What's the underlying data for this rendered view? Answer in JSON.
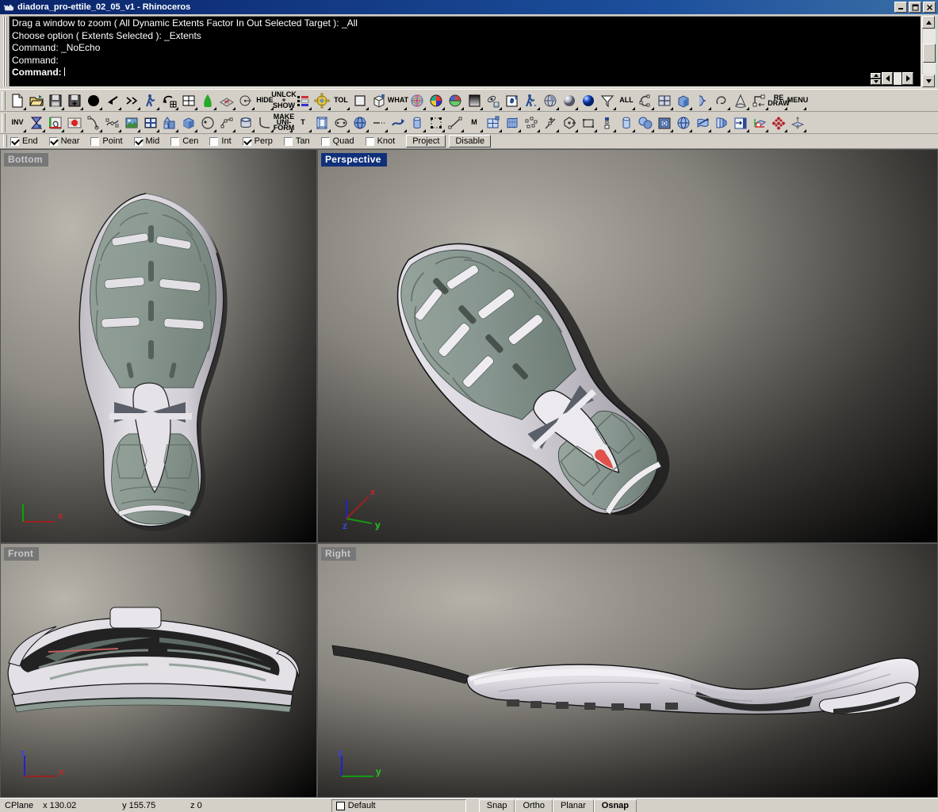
{
  "window": {
    "title": "diadora_pro-ettile_02_05_v1 - Rhinoceros",
    "app_icon": "rhino-icon",
    "minimize": "_",
    "maximize": "□",
    "close": "×"
  },
  "command_area": {
    "history": [
      "Drag a window to zoom ( All  Dynamic  Extents  Factor  In  Out  Selected  Target ): _All",
      "Choose option ( Extents  Selected ): _Extents",
      "Command: _NoEcho",
      "Command:"
    ],
    "prompt": "Command:",
    "input_value": ""
  },
  "toolbar_row1": [
    {
      "name": "new-file-button",
      "label": "",
      "icon": "new-page-icon"
    },
    {
      "name": "open-file-button",
      "label": "",
      "icon": "open-folder-icon"
    },
    {
      "name": "save-file-button",
      "label": "",
      "icon": "floppy-save-icon"
    },
    {
      "name": "save-as-button",
      "label": "",
      "icon": "floppy-save-as-icon"
    },
    {
      "name": "select-all-solid-button",
      "label": "",
      "icon": "filled-circle-icon"
    },
    {
      "name": "undo-button",
      "label": "",
      "icon": "undo-arrow-icon"
    },
    {
      "name": "redo-button",
      "label": "",
      "icon": "redo-arrow-icon"
    },
    {
      "name": "walk-person-button",
      "label": "",
      "icon": "walking-person-icon"
    },
    {
      "name": "undo-view-change-button",
      "label": "",
      "icon": "undo-view-icon"
    },
    {
      "name": "viewport-layout-button",
      "label": "",
      "icon": "four-pane-grid-icon"
    },
    {
      "name": "surface-from-curve-button",
      "label": "",
      "icon": "green-leaf-icon"
    },
    {
      "name": "mesh-from-surface-button",
      "label": "",
      "icon": "mesh-plane-icon"
    },
    {
      "name": "point-object-button",
      "label": "",
      "icon": "point-target-icon"
    },
    {
      "name": "hide-objects-button",
      "label": "HIDE",
      "icon": "text-hide-icon"
    },
    {
      "name": "unlock-show-button",
      "label": "UNLCK|+|SHOW",
      "icon": "text-unlock-show-icon"
    },
    {
      "name": "layers-button",
      "label": "",
      "icon": "layers-stripes-icon"
    },
    {
      "name": "options-gear-button",
      "label": "",
      "icon": "gear-icon"
    },
    {
      "name": "tolerance-button",
      "label": "TOL",
      "icon": "text-tolerance-icon"
    },
    {
      "name": "planar-surface-button",
      "label": "",
      "icon": "square-plane-icon"
    },
    {
      "name": "box-wireframe-button",
      "label": "",
      "icon": "box-wireframe-icon"
    },
    {
      "name": "what-info-button",
      "label": "WHAT",
      "icon": "question-what-icon"
    },
    {
      "name": "color-wheel-button",
      "label": "",
      "icon": "color-wheel-icon"
    },
    {
      "name": "render-color-button",
      "label": "",
      "icon": "rainbow-sphere-icon"
    },
    {
      "name": "material-color-button",
      "label": "",
      "icon": "color-sphere-wheel-icon"
    },
    {
      "name": "gradient-background-button",
      "label": "",
      "icon": "gradient-square-icon"
    },
    {
      "name": "render-preview-button",
      "label": "",
      "icon": "orbit-render-icon"
    },
    {
      "name": "render-button",
      "label": "",
      "icon": "render-paint-icon"
    },
    {
      "name": "animation-person-button",
      "label": "",
      "icon": "walking-person-blue-icon"
    },
    {
      "name": "shade-wireframe-button",
      "label": "",
      "icon": "shaded-globe-icon"
    },
    {
      "name": "shaded-view-button",
      "label": "",
      "icon": "gray-sphere-icon"
    },
    {
      "name": "rendered-view-button",
      "label": "",
      "icon": "blue-sphere-icon"
    },
    {
      "name": "selection-filter-button",
      "label": "",
      "icon": "funnel-filter-icon"
    },
    {
      "name": "select-all-button",
      "label": "ALL",
      "icon": "text-all-icon"
    },
    {
      "name": "select-curves-button",
      "label": "",
      "icon": "select-curve-icon"
    },
    {
      "name": "viewport-four-button",
      "label": "",
      "icon": "four-viewport-icon"
    },
    {
      "name": "solid-box-button",
      "label": "",
      "icon": "solid-box-icon"
    },
    {
      "name": "surface-blend-button",
      "label": "",
      "icon": "blend-surface-icon"
    },
    {
      "name": "loft-button",
      "label": "",
      "icon": "loop-curve-icon"
    },
    {
      "name": "cone-button",
      "label": "",
      "icon": "cone-icon"
    },
    {
      "name": "transform-button",
      "label": "",
      "icon": "transform-axis-icon"
    },
    {
      "name": "redraw-button",
      "label": "RE|DRAW",
      "icon": "text-redraw-icon"
    },
    {
      "name": "menu-button",
      "label": "MENU",
      "icon": "text-menu-icon"
    }
  ],
  "toolbar_row2": [
    {
      "name": "invert-selection-button",
      "label": "INV",
      "icon": "invert-trash-icon"
    },
    {
      "name": "spotlight-button",
      "label": "",
      "icon": "spotlight-icon"
    },
    {
      "name": "curve-tools-button",
      "label": "",
      "icon": "curve-surface-icon"
    },
    {
      "name": "record-history-button",
      "label": "",
      "icon": "record-red-dot-icon"
    },
    {
      "name": "control-point-curve-button",
      "label": "",
      "icon": "cp-curve-icon"
    },
    {
      "name": "interpolate-curve-button",
      "label": "",
      "icon": "interp-curve-icon"
    },
    {
      "name": "background-bitmap-button",
      "label": "",
      "icon": "picture-frame-icon"
    },
    {
      "name": "new-window-button",
      "label": "",
      "icon": "window-pane-icon"
    },
    {
      "name": "boolean-union-button",
      "label": "",
      "icon": "boolean-shapes-icon"
    },
    {
      "name": "cube-solid-button",
      "label": "",
      "icon": "blue-cube-icon"
    },
    {
      "name": "circle-center-button",
      "label": "",
      "icon": "circle-center-icon"
    },
    {
      "name": "polyline-button",
      "label": "",
      "icon": "polyline-icon"
    },
    {
      "name": "cylinder-button",
      "label": "",
      "icon": "cylinder-can-icon"
    },
    {
      "name": "fillet-corner-button",
      "label": "",
      "icon": "fillet-corner-icon"
    },
    {
      "name": "make-uniform-button",
      "label": "MAKE|UNI-|FORM",
      "icon": "text-make-uniform-icon"
    },
    {
      "name": "text-object-button",
      "label": "T",
      "icon": "text-tool-icon"
    },
    {
      "name": "extrude-surface-button",
      "label": "",
      "icon": "extrude-icon"
    },
    {
      "name": "ellipse-button",
      "label": "",
      "icon": "ellipse-icon"
    },
    {
      "name": "sphere-button",
      "label": "",
      "icon": "wire-globe-icon"
    },
    {
      "name": "line-dash-button",
      "label": "",
      "icon": "dashed-line-icon"
    },
    {
      "name": "flow-along-curve-button",
      "label": "",
      "icon": "flow-ribbon-icon"
    },
    {
      "name": "pipe-button",
      "label": "",
      "icon": "blue-cylinder-icon"
    },
    {
      "name": "group-button",
      "label": "",
      "icon": "group-points-icon"
    },
    {
      "name": "line-segment-button",
      "label": "",
      "icon": "line-segment-icon"
    },
    {
      "name": "move-button",
      "label": "M",
      "icon": "move-m-icon"
    },
    {
      "name": "split-surface-button",
      "label": "",
      "icon": "split-quad-icon"
    },
    {
      "name": "mesh-surface-button",
      "label": "",
      "icon": "mesh-surface-icon"
    },
    {
      "name": "point-cloud-button",
      "label": "",
      "icon": "point-cloud-icon"
    },
    {
      "name": "add-point-curve-button",
      "label": "",
      "icon": "add-point-line-icon"
    },
    {
      "name": "polygon-button",
      "label": "",
      "icon": "polygon-icon"
    },
    {
      "name": "rectangle-button",
      "label": "",
      "icon": "rectangle-icon"
    },
    {
      "name": "distribute-button",
      "label": "",
      "icon": "distribute-icon"
    },
    {
      "name": "tube-button",
      "label": "",
      "icon": "tube-icon"
    },
    {
      "name": "boolean-split-button",
      "label": "",
      "icon": "boolean-sphere-icon"
    },
    {
      "name": "section-button",
      "label": "",
      "icon": "section-box-icon"
    },
    {
      "name": "revolve-button",
      "label": "",
      "icon": "revolve-globe-icon"
    },
    {
      "name": "twist-button",
      "label": "",
      "icon": "twist-icon"
    },
    {
      "name": "unroll-surface-button",
      "label": "",
      "icon": "unroll-icon"
    },
    {
      "name": "insert-block-button",
      "label": "",
      "icon": "insert-block-icon"
    },
    {
      "name": "cplane-button",
      "label": "",
      "icon": "cplane-icon"
    },
    {
      "name": "array-polar-button",
      "label": "",
      "icon": "array-diamond-icon"
    },
    {
      "name": "mirror-button",
      "label": "",
      "icon": "mirror-icon"
    }
  ],
  "osnap": {
    "items": [
      {
        "label": "End",
        "checked": true
      },
      {
        "label": "Near",
        "checked": true
      },
      {
        "label": "Point",
        "checked": false
      },
      {
        "label": "Mid",
        "checked": true
      },
      {
        "label": "Cen",
        "checked": false
      },
      {
        "label": "Int",
        "checked": false
      },
      {
        "label": "Perp",
        "checked": true
      },
      {
        "label": "Tan",
        "checked": false
      },
      {
        "label": "Quad",
        "checked": false
      },
      {
        "label": "Knot",
        "checked": false
      }
    ],
    "project_label": "Project",
    "disable_label": "Disable"
  },
  "viewports": [
    {
      "name": "bottom",
      "label": "Bottom",
      "active": false,
      "axes": [
        {
          "letter": "x",
          "color": "#cc0000"
        }
      ]
    },
    {
      "name": "perspective",
      "label": "Perspective",
      "active": true,
      "axes": [
        {
          "letter": "x",
          "color": "#cc0000"
        },
        {
          "letter": "y",
          "color": "#00cc00"
        },
        {
          "letter": "z",
          "color": "#3333dd"
        }
      ]
    },
    {
      "name": "front",
      "label": "Front",
      "active": false,
      "axes": [
        {
          "letter": "x",
          "color": "#cc0000"
        },
        {
          "letter": "z",
          "color": "#3333dd"
        }
      ]
    },
    {
      "name": "right",
      "label": "Right",
      "active": false,
      "axes": [
        {
          "letter": "y",
          "color": "#00cc00"
        },
        {
          "letter": "z",
          "color": "#3333dd"
        }
      ]
    }
  ],
  "model": {
    "subject": "running-shoe-outsole",
    "colors": {
      "tread_green": "#8b9a92",
      "tread_green_dark": "#6e7d75",
      "midsole_light": "#d9d5dd",
      "midsole_shadow": "#a9a5ad",
      "accent_red": "#e0524a",
      "logo_dark": "#5a5f6a",
      "outline_dark": "#1a1a1a"
    }
  },
  "status_bar": {
    "cplane_label": "CPlane",
    "x_label": "x 130.02",
    "y_label": "y 155.75",
    "z_label": "z 0",
    "layer": "Default",
    "buttons": [
      {
        "label": "Snap",
        "active": false
      },
      {
        "label": "Ortho",
        "active": false
      },
      {
        "label": "Planar",
        "active": false
      },
      {
        "label": "Osnap",
        "active": true
      }
    ]
  }
}
